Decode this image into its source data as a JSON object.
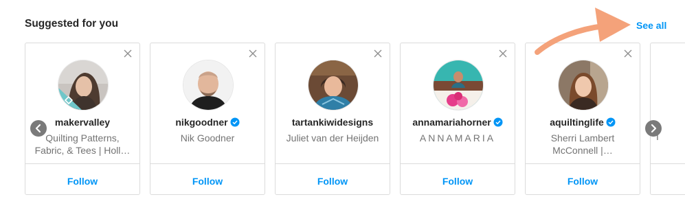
{
  "header": {
    "title": "Suggested for you",
    "see_all_label": "See all"
  },
  "colors": {
    "accent": "#0095f6",
    "annotation_arrow": "#f4a27a",
    "verified_badge": "#0095f6"
  },
  "suggestions": [
    {
      "username": "makervalley",
      "verified": false,
      "subtitle": "Quilting Patterns, Fabric, & Tees | Holl…",
      "follow_label": "Follow"
    },
    {
      "username": "nikgoodner",
      "verified": true,
      "subtitle": "Nik Goodner",
      "follow_label": "Follow"
    },
    {
      "username": "tartankiwidesigns",
      "verified": false,
      "subtitle": "Juliet van der Heijden",
      "follow_label": "Follow"
    },
    {
      "username": "annamariahorner",
      "verified": true,
      "subtitle": "ANNAMARIA",
      "follow_label": "Follow"
    },
    {
      "username": "aquiltinglife",
      "verified": true,
      "subtitle": "Sherri Lambert McConnell |…",
      "follow_label": "Follow"
    }
  ],
  "partial_card": {
    "subtitle_fragment": "I"
  },
  "icons": {
    "close": "close-icon",
    "verified": "verified-badge-icon",
    "prev": "chevron-left-icon",
    "next": "chevron-right-icon"
  }
}
